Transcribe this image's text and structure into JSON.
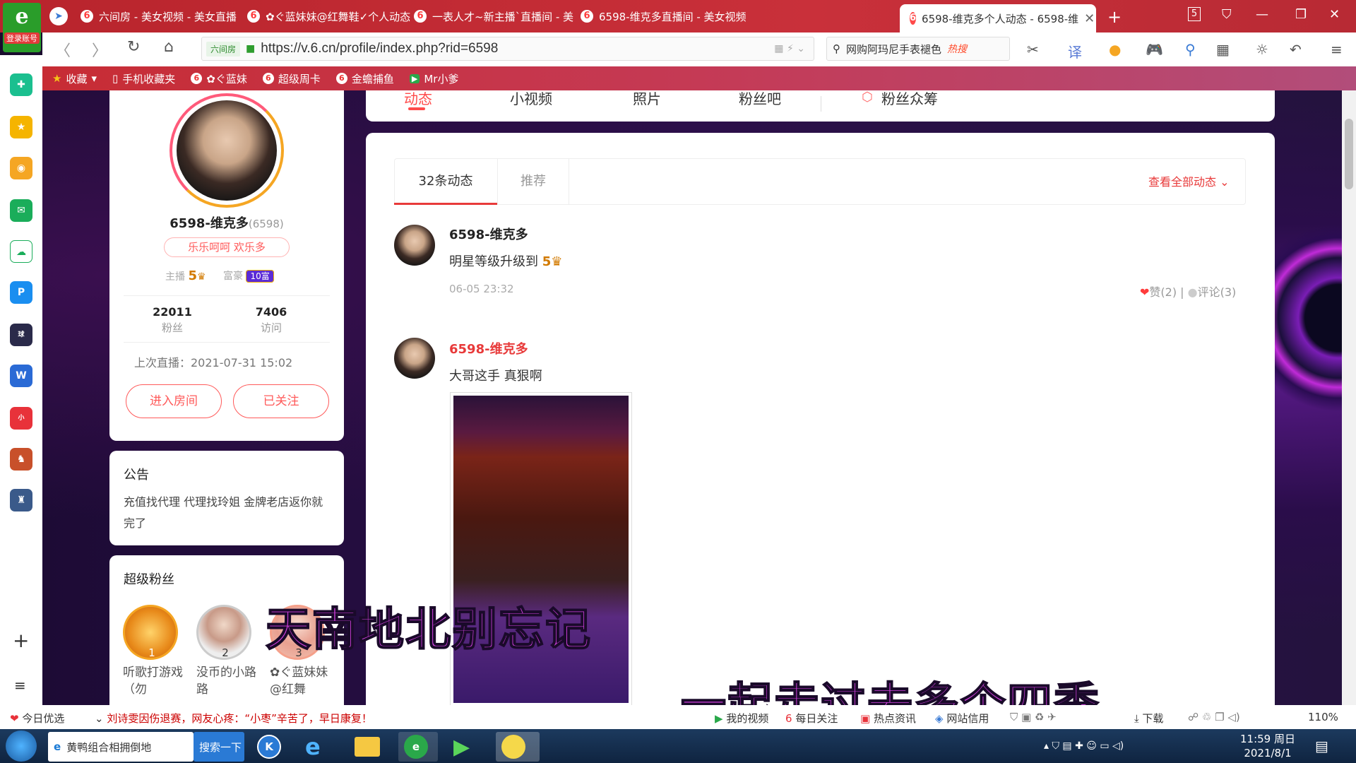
{
  "browser": {
    "logo_label": "登录账号",
    "tabs": [
      {
        "title": "六间房 - 美女视频 - 美女直播"
      },
      {
        "title": "✿ぐ蓝妹妹@红舞鞋✓个人动态"
      },
      {
        "title": "一表人才~新主播`直播间 - 美"
      },
      {
        "title": "6598-维克多直播间 - 美女视频"
      },
      {
        "title": "6598-维克多个人动态 - 6598-维"
      }
    ],
    "tab_count": "5",
    "url": "https://v.6.cn/profile/index.php?rid=6598",
    "site_badge": "六间房",
    "search_text": "网购阿玛尼手表褪色",
    "search_hot": "热搜",
    "bookmarks": [
      {
        "label": "收藏"
      },
      {
        "label": "手机收藏夹"
      },
      {
        "label": "✿ぐ蓝妹"
      },
      {
        "label": "超级周卡"
      },
      {
        "label": "金蟾捕鱼"
      },
      {
        "label": "Mr小爹"
      }
    ]
  },
  "profile": {
    "name": "6598-维克多",
    "rid": "(6598)",
    "motto": "乐乐呵呵 欢乐多",
    "anchor_label": "主播",
    "anchor_level": "5",
    "rich_label": "富豪",
    "rich_badge": "10富",
    "fans_count": "22011",
    "fans_label": "粉丝",
    "visits_count": "7406",
    "visits_label": "访问",
    "last_live": "上次直播：2021-07-31 15:02",
    "enter_room": "进入房间",
    "followed": "已关注"
  },
  "notice": {
    "title": "公告",
    "text": "充值找代理 代理找玲姐 金牌老店返你就完了"
  },
  "super_fans": {
    "title": "超级粉丝",
    "fans": [
      {
        "rank": "1",
        "name": "听歌打游戏（勿"
      },
      {
        "rank": "2",
        "name": "没币的小路路"
      },
      {
        "rank": "3",
        "name": "✿ぐ蓝妹妹@红舞"
      }
    ]
  },
  "profile_tabs": [
    "动态",
    "小视频",
    "照片",
    "粉丝吧",
    "粉丝众筹"
  ],
  "feed": {
    "tabs": [
      "32条动态",
      "推荐"
    ],
    "view_all": "查看全部动态",
    "posts": [
      {
        "user": "6598-维克多",
        "text": "明星等级升级到",
        "level": "5",
        "time": "06-05 23:32",
        "likes": "赞(2)",
        "comments": "评论(3)"
      },
      {
        "user": "6598-维克多",
        "text": "大哥这手 真狠啊"
      }
    ]
  },
  "subtitles": [
    "天南地北别忘记",
    "一起走过去多个四季"
  ],
  "statusbar": {
    "news_label": "今日优选",
    "headline": "刘诗雯因伤退赛，网友心疼：“小枣”辛苦了，早日康复！",
    "items": [
      "我的视频",
      "每日关注",
      "热点资讯",
      "网站信用",
      "下载"
    ],
    "zoom": "110%"
  },
  "taskbar": {
    "ie_task": "黄鸭组合相拥倒地",
    "search_btn": "搜索一下",
    "time": "11:59 周日",
    "date": "2021/8/1"
  }
}
